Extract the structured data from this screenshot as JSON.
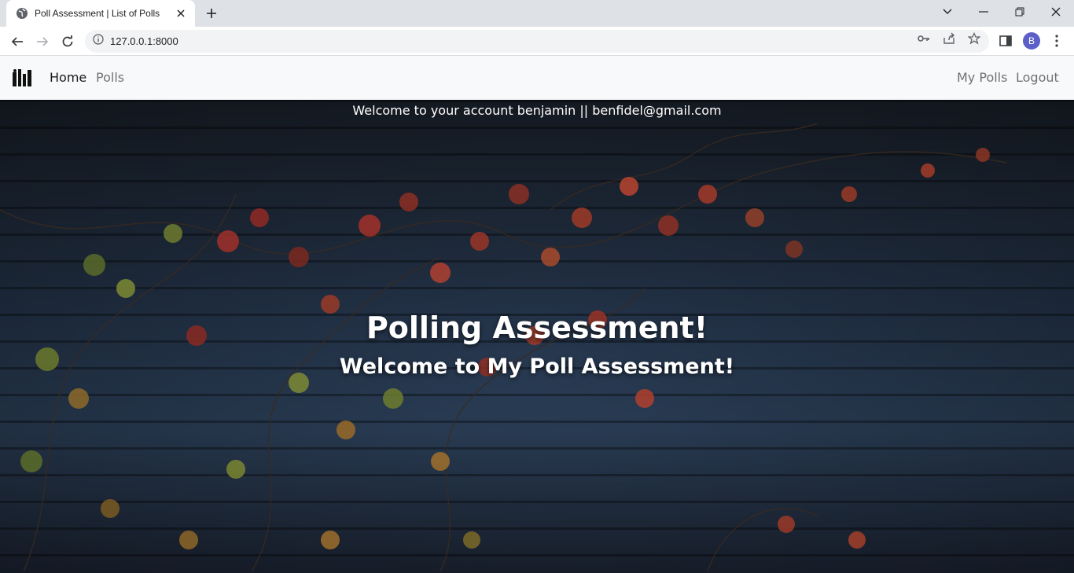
{
  "browser": {
    "tab_title": "Poll Assessment | List of Polls",
    "url": "127.0.0.1:8000",
    "profile_initial": "B"
  },
  "navbar": {
    "links_left": [
      "Home",
      "Polls"
    ],
    "links_right": [
      "My Polls",
      "Logout"
    ]
  },
  "hero": {
    "welcome_line": "Welcome to your account benjamin || benfidel@gmail.com",
    "title": "Polling Assessment!",
    "subtitle": "Welcome to My Poll Assessment!"
  }
}
